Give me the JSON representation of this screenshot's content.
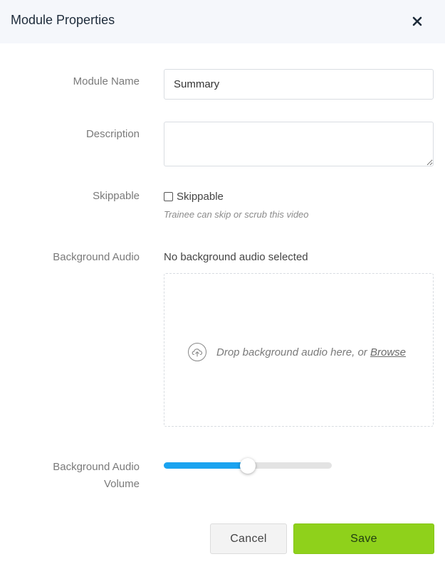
{
  "dialog": {
    "title": "Module Properties",
    "close_icon": "close-icon"
  },
  "fields": {
    "module_name": {
      "label": "Module Name",
      "value": "Summary"
    },
    "description": {
      "label": "Description",
      "value": ""
    },
    "skippable": {
      "label": "Skippable",
      "checkbox_label": "Skippable",
      "checked": false,
      "hint": "Trainee can skip or scrub this video"
    },
    "background_audio": {
      "label": "Background Audio",
      "status": "No background audio selected",
      "drop_text": "Drop background audio here, or ",
      "browse_label": "Browse",
      "upload_icon": "cloud-upload-icon"
    },
    "background_audio_volume": {
      "label_line1": "Background Audio",
      "label_line2": "Volume",
      "value_fraction": 0.5
    }
  },
  "actions": {
    "cancel_label": "Cancel",
    "save_label": "Save"
  },
  "colors": {
    "header_bg": "#f5f7fb",
    "slider_fill": "#1aa3f0",
    "save_button": "#8fd11b"
  }
}
